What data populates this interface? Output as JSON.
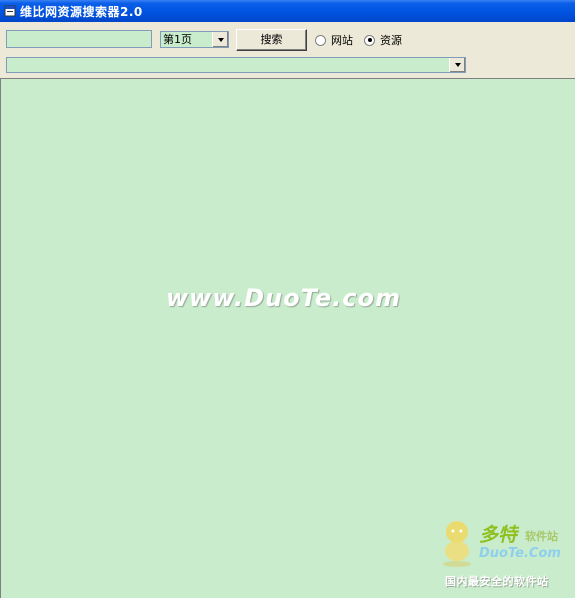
{
  "window": {
    "title": "维比网资源搜索器2.0"
  },
  "toolbar": {
    "search_value": "",
    "page_select": {
      "value": "第1页"
    },
    "search_button": "搜索",
    "radio_options": [
      {
        "label": "网站",
        "checked": false
      },
      {
        "label": "资源",
        "checked": true
      }
    ],
    "url_value": ""
  },
  "content": {
    "watermark": "www.DuoTe.com"
  },
  "logo": {
    "title_cn": "多特",
    "title_sub": "软件站",
    "domain": "DuoTe.Com",
    "tagline": "国内最安全的软件站"
  },
  "colors": {
    "title_bar": "#0A5FE8",
    "content_bg": "#C8ECCC",
    "window_bg": "#ECE9D8"
  }
}
